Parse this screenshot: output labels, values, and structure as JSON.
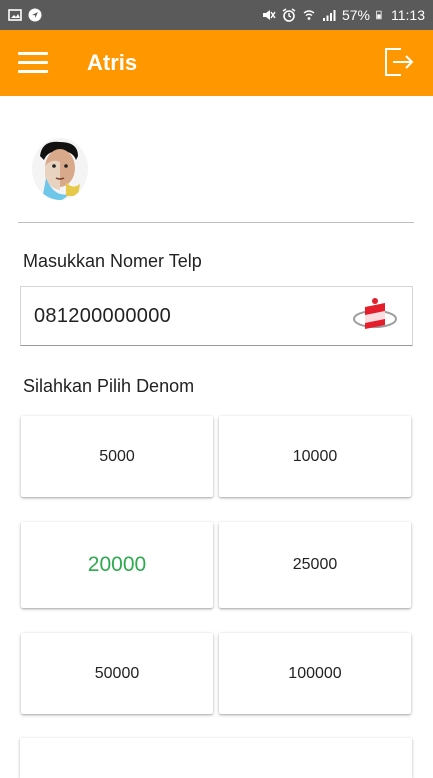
{
  "status_bar": {
    "battery": "57%",
    "time": "11:13"
  },
  "app_bar": {
    "title": "Atris"
  },
  "form": {
    "phone_label": "Masukkan Nomer Telp",
    "phone_value": "081200000000",
    "denom_label": "Silahkan Pilih Denom"
  },
  "denoms": [
    "5000",
    "10000",
    "20000",
    "25000",
    "50000",
    "100000"
  ],
  "selected_denom": "20000",
  "colors": {
    "app_bar": "#ff9800",
    "selected": "#2eaa4f",
    "status_bar": "#5a5a5a"
  }
}
